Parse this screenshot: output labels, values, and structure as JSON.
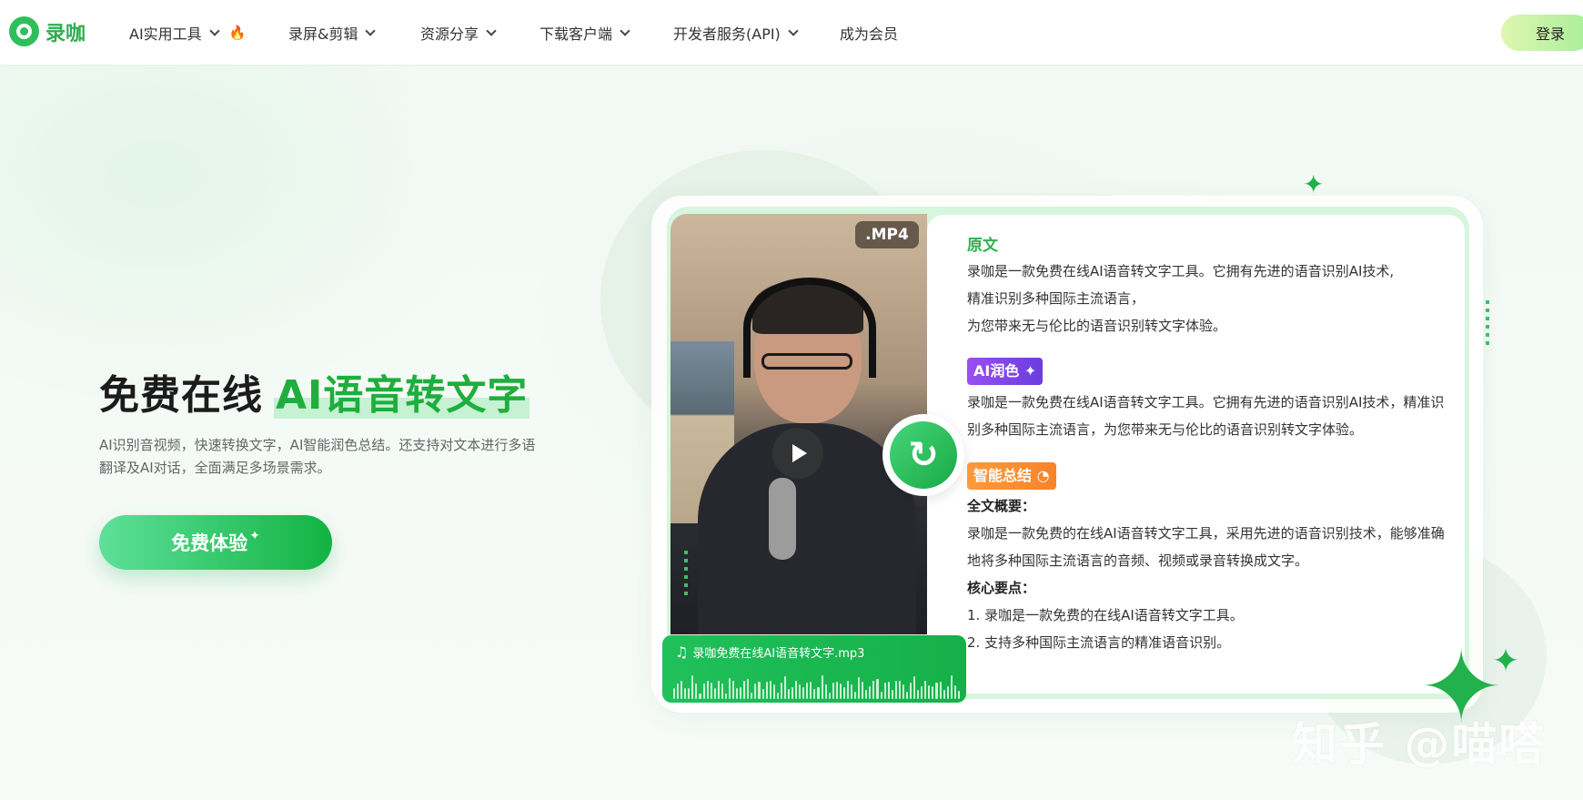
{
  "brand": {
    "name": "录咖"
  },
  "nav": {
    "items": [
      {
        "label": "AI实用工具",
        "has_dropdown": true,
        "badge_icon": "fire-icon"
      },
      {
        "label": "录屏&剪辑",
        "has_dropdown": true
      },
      {
        "label": "资源分享",
        "has_dropdown": true
      },
      {
        "label": "下载客户端",
        "has_dropdown": true
      },
      {
        "label": "开发者服务(API)",
        "has_dropdown": true
      },
      {
        "label": "成为会员",
        "has_dropdown": false
      }
    ],
    "login_label": "登录"
  },
  "hero": {
    "title_plain": "免费在线",
    "title_highlight": "AI语音转文字",
    "description": "AI识别音视频，快速转换文字，AI智能润色总结。还支持对文本进行多语翻译及AI对话，全面满足多场景需求。",
    "cta_label": "免费体验",
    "cta_spark": "✦"
  },
  "demo": {
    "video_format_badge": ".MP4",
    "audio_file_name": "录咖免费在线AI语音转文字.mp3",
    "original": {
      "title": "原文",
      "lines": [
        "录咖是一款免费在线AI语音转文字工具。它拥有先进的语音识别AI技术,",
        "精准识别多种国际主流语言，",
        "为您带来无与伦比的语音识别转文字体验。"
      ]
    },
    "polish": {
      "tag": "AI润色 ✦",
      "text": "录咖是一款免费在线AI语音转文字工具。它拥有先进的语音识别AI技术，精准识别多种国际主流语言，为您带来无与伦比的语音识别转文字体验。"
    },
    "summary": {
      "tag": "智能总结 ◔",
      "overview_label": "全文概要：",
      "overview_text": "录咖是一款免费的在线AI语音转文字工具，采用先进的语音识别技术，能够准确地将多种国际主流语言的音频、视频或录音转换成文字。",
      "key_points_label": "核心要点：",
      "key_points": [
        "1. 录咖是一款免费的在线AI语音转文字工具。",
        "2. 支持多种国际主流语言的精准语音识别。"
      ]
    }
  },
  "watermark": "知乎 @喵嗒",
  "colors": {
    "brand_green": "#2fb14f",
    "purple_tag": "#7a44e6",
    "orange_tag": "#f7832a"
  }
}
